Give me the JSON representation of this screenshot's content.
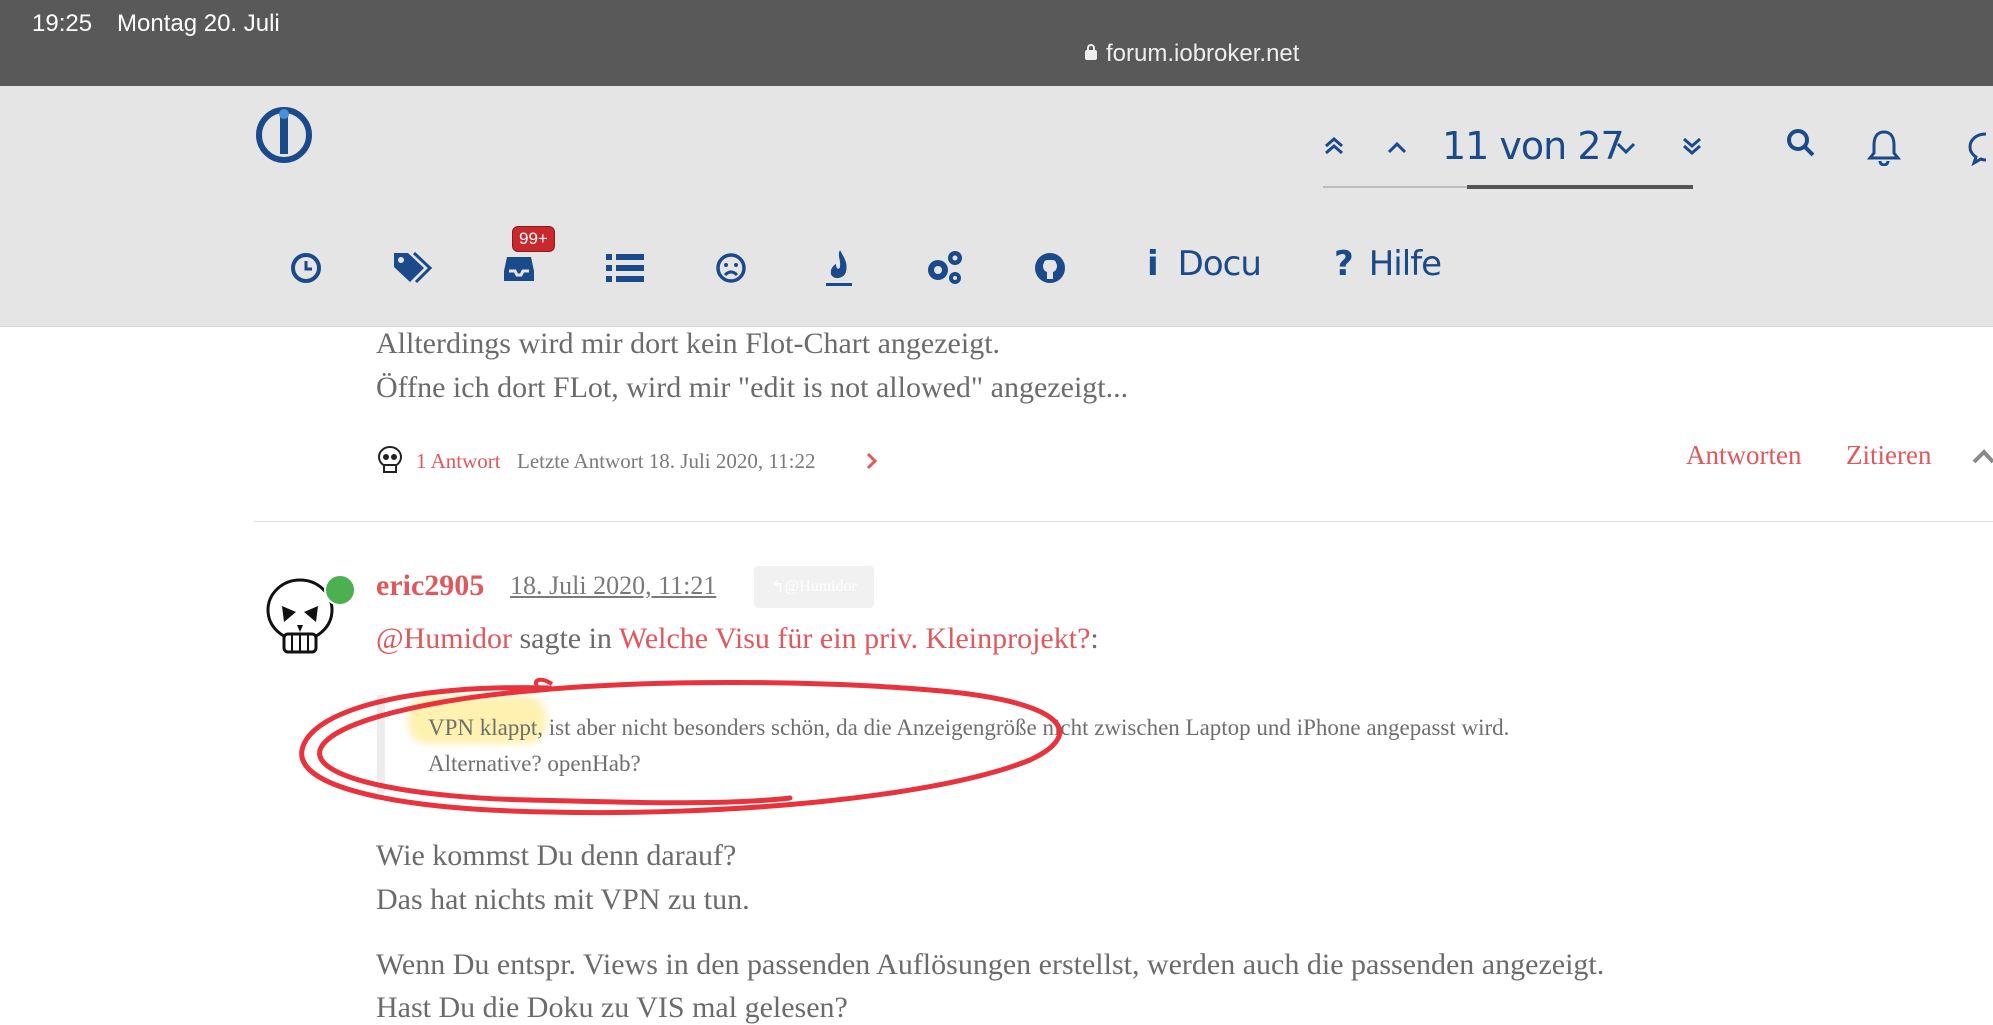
{
  "status_bar": {
    "time": "19:25",
    "date": "Montag 20. Juli",
    "url": "forum.iobroker.net"
  },
  "header": {
    "pager_label": "11 von 27",
    "pager_progress": 0.41,
    "nav": {
      "unread_badge": "99+",
      "docu_label": "Docu",
      "hilfe_label": "Hilfe"
    }
  },
  "prev_post": {
    "line1": "Allterdings wird mir dort kein Flot-Chart angezeigt.",
    "line2": "Öffne ich dort FLot, wird mir \"edit is not allowed\" angezeigt...",
    "replies_link": "1 Antwort",
    "last_reply": "Letzte Antwort 18. Juli 2020, 11:22",
    "actions": {
      "reply": "Antworten",
      "quote": "Zitieren"
    }
  },
  "post": {
    "author": "eric2905",
    "timestamp": "18. Juli 2020, 11:21",
    "reply_to": "@Humidor",
    "mention": "@Humidor",
    "said_in": "sagte in",
    "topic_link": "Welche Visu für ein priv. Kleinprojekt?",
    "colon": ":",
    "quote_line1": "VPN klappt, ist aber nicht besonders schön, da die Anzeigengröße nicht zwischen Laptop und iPhone angepasst wird.",
    "quote_line2": "Alternative? openHab?",
    "body1": "Wie kommst Du denn darauf?",
    "body2": "Das hat nichts mit VPN zu tun.",
    "body3": "Wenn Du entspr. Views in den passenden Auflösungen erstellst, werden auch die passenden angezeigt.",
    "body4": "Hast Du die Doku zu VIS mal gelesen?"
  },
  "colors": {
    "accent_red": "#e0585b",
    "nav_blue": "#1b4a8a",
    "online": "#4caf50"
  }
}
